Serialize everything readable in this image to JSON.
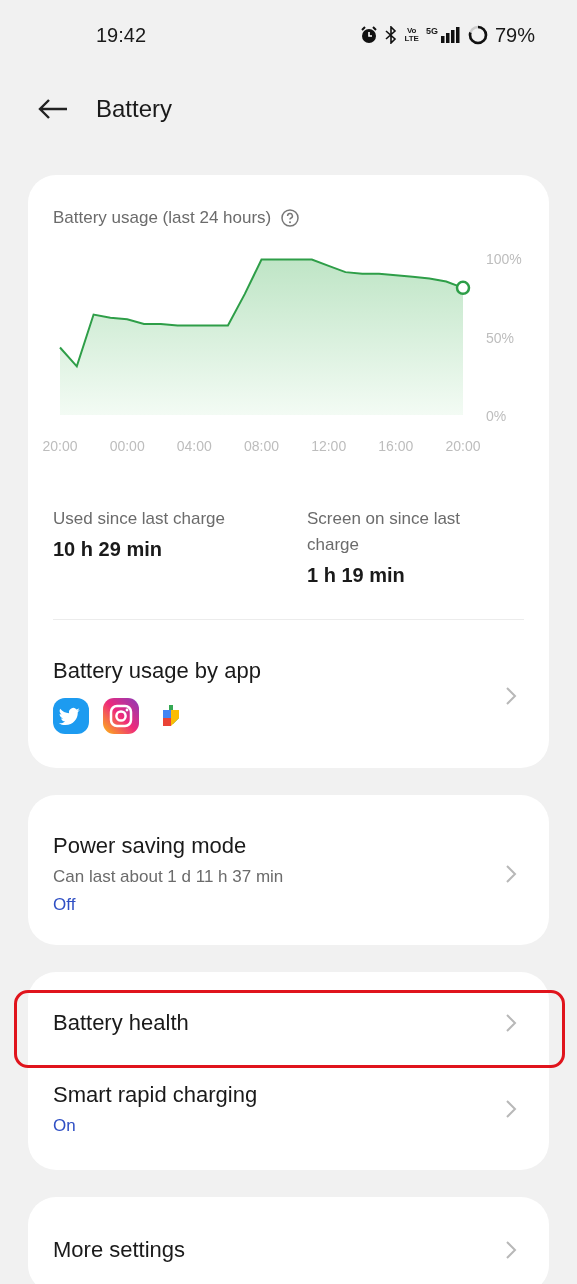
{
  "status_bar": {
    "time": "19:42",
    "volte": [
      "Vo",
      "LTE"
    ],
    "network": "5G",
    "battery": "79%"
  },
  "header": {
    "title": "Battery"
  },
  "usage_card": {
    "title": "Battery usage (last 24 hours)",
    "chart_data": {
      "type": "area",
      "categories": [
        "20:00",
        null,
        null,
        null,
        "00:00",
        null,
        null,
        null,
        "04:00",
        null,
        null,
        null,
        "08:00",
        null,
        null,
        null,
        "12:00",
        null,
        null,
        null,
        "16:00",
        null,
        null,
        null,
        "20:00"
      ],
      "series": [
        {
          "color": "#2e9e48",
          "values": [
            43,
            31,
            64,
            62,
            61,
            58,
            58,
            57,
            57,
            57,
            57,
            77,
            99,
            99,
            99,
            99,
            95,
            91,
            90,
            90,
            89,
            88,
            87,
            85,
            81
          ]
        }
      ],
      "ylim": [
        0,
        100
      ],
      "yticks": [
        {
          "value": 0,
          "label": "0%"
        },
        {
          "value": 50,
          "label": "50%"
        },
        {
          "value": 100,
          "label": "100%"
        }
      ]
    },
    "stats": [
      {
        "label": "Used since last charge",
        "value": "10 h 29 min"
      },
      {
        "label": "Screen on since last charge",
        "value": "1 h 19 min"
      }
    ],
    "by_app": {
      "title": "Battery usage by app",
      "apps": [
        {
          "kind": "bird"
        },
        {
          "kind": "camera"
        },
        {
          "kind": "puzzle"
        }
      ]
    }
  },
  "groups": [
    [
      {
        "title": "Power saving mode",
        "subtitle": "Can last about 1 d 11 h 37 min",
        "status": "Off",
        "highlighted": false
      }
    ],
    [
      {
        "title": "Battery health",
        "highlighted": true
      },
      {
        "title": "Smart rapid charging",
        "status": "On",
        "highlighted": false
      }
    ],
    [
      {
        "title": "More settings",
        "highlighted": false
      }
    ]
  ]
}
